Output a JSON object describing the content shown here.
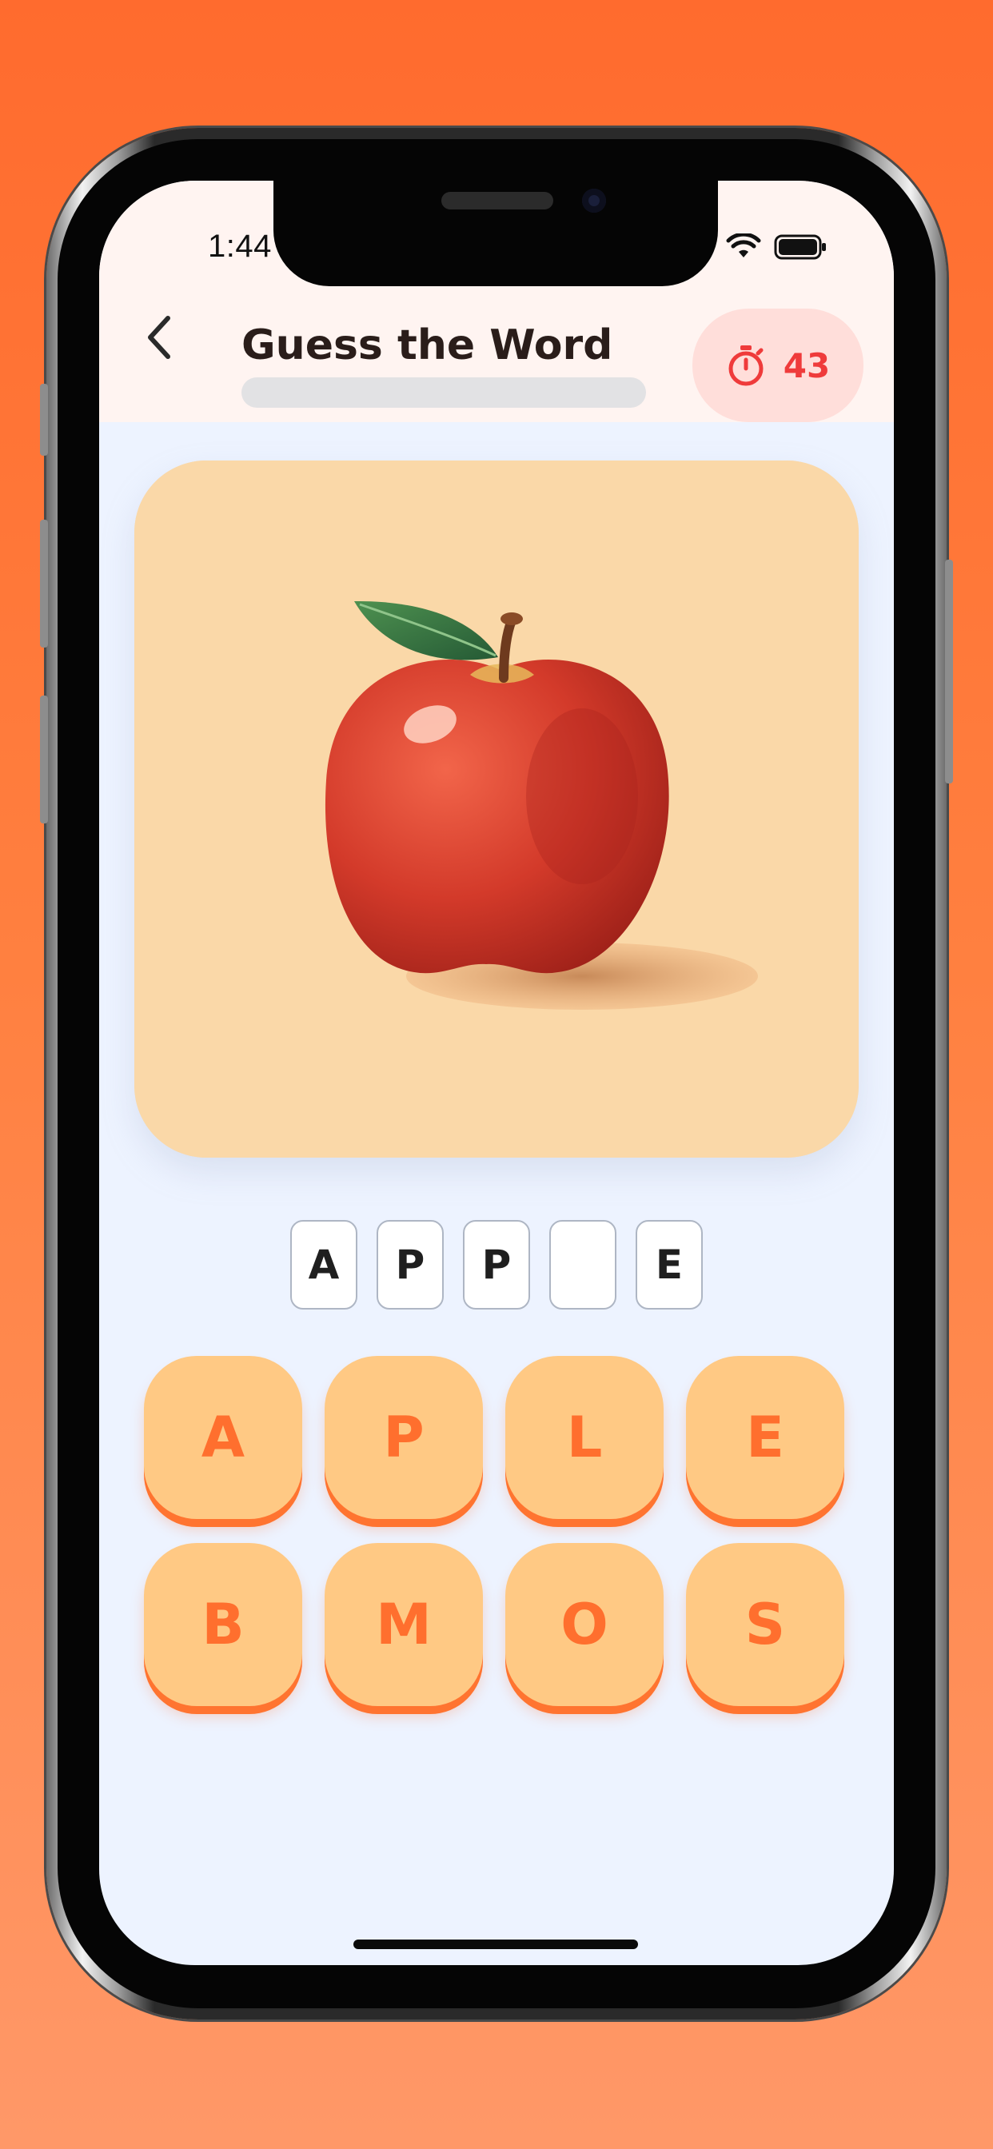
{
  "status_bar": {
    "time": "1:44"
  },
  "header": {
    "title": "Guess the Word",
    "progress": 0,
    "timer_value": "43"
  },
  "puzzle": {
    "image": "apple-illustration",
    "answer_slots": [
      "A",
      "P",
      "P",
      "",
      "E"
    ]
  },
  "letter_tiles": [
    "A",
    "P",
    "L",
    "E",
    "B",
    "M",
    "O",
    "S"
  ],
  "colors": {
    "background_orange": "#FF6B2E",
    "timer_red": "#EF3B3B",
    "tile_fill": "#FFC984",
    "tile_text": "#FF6F2E",
    "screen_bg": "#EDF3FF"
  },
  "icons": {
    "back": "chevron-left-icon",
    "timer": "stopwatch-icon"
  }
}
